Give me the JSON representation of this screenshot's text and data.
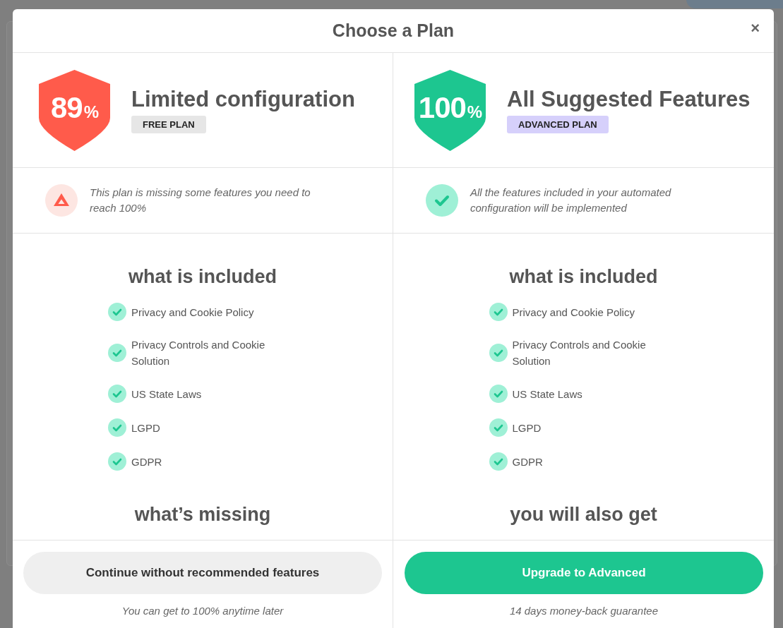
{
  "dialog": {
    "title": "Choose a Plan",
    "close_label": "×"
  },
  "plans": [
    {
      "kind": "free",
      "color": "#ff5b4b",
      "score": "89",
      "score_unit": "%",
      "title": "Limited configuration",
      "badge": "FREE PLAN",
      "note": {
        "kind": "warning",
        "text": "This plan is missing some features you need to reach 100%"
      },
      "sections": [
        {
          "heading": "what is included",
          "items": [
            {
              "label": "Privacy and Cookie Policy"
            },
            {
              "label": "Privacy Controls and Cookie Solution"
            },
            {
              "label": "US State Laws"
            },
            {
              "label": "LGPD"
            },
            {
              "label": "GDPR"
            }
          ]
        },
        {
          "heading": "what’s missing"
        }
      ],
      "button": "Continue without recommended features",
      "caption": "You can get to 100% anytime later"
    },
    {
      "kind": "advanced",
      "color": "#1dc690",
      "score": "100",
      "score_unit": "%",
      "title": "All Suggested Features",
      "badge": "ADVANCED PLAN",
      "note": {
        "kind": "success",
        "text": "All the features included in your automated configuration will be implemented"
      },
      "sections": [
        {
          "heading": "what is included",
          "items": [
            {
              "label": "Privacy and Cookie Policy"
            },
            {
              "label": "Privacy Controls and Cookie Solution"
            },
            {
              "label": "US State Laws"
            },
            {
              "label": "LGPD"
            },
            {
              "label": "GDPR"
            }
          ]
        },
        {
          "heading": "you will also get"
        }
      ],
      "button": "Upgrade to Advanced",
      "caption": "14 days money-back guarantee"
    }
  ]
}
